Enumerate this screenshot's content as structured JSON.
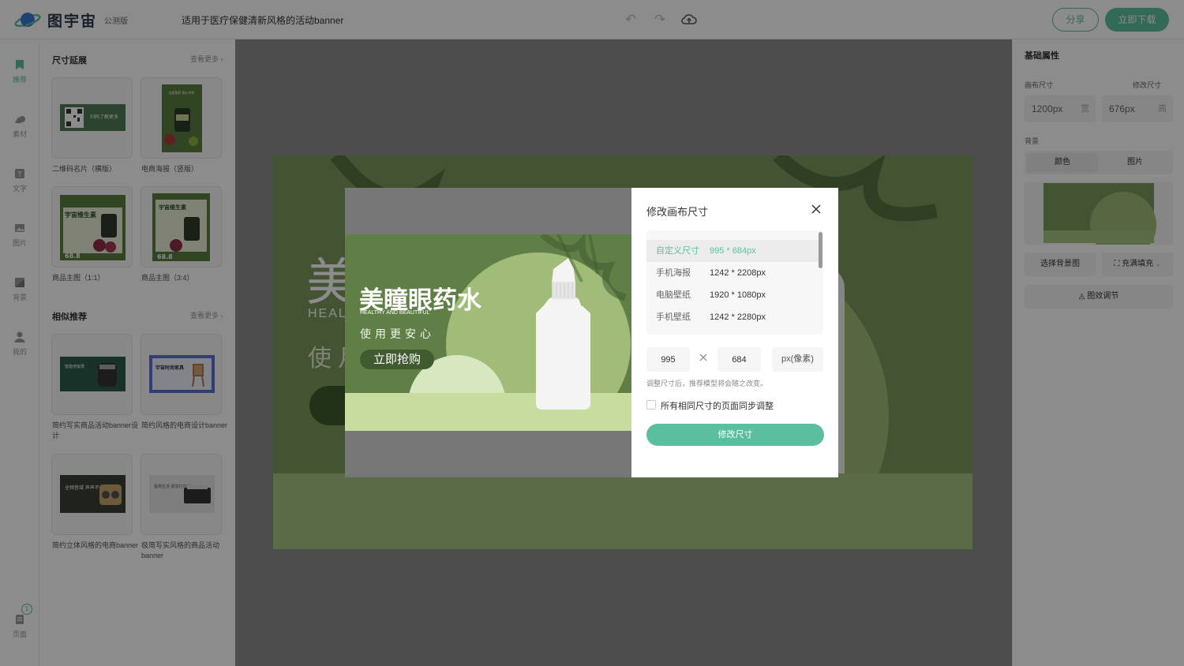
{
  "header": {
    "logo_text": "图宇宙",
    "logo_badge": "公测版",
    "doc_title": "适用于医疗保健清新风格的活动banner",
    "share_label": "分享",
    "download_label": "立即下载"
  },
  "leftnav": {
    "items": [
      {
        "label": "推荐",
        "icon": "recommend-icon"
      },
      {
        "label": "素材",
        "icon": "material-icon"
      },
      {
        "label": "文字",
        "icon": "text-icon"
      },
      {
        "label": "图片",
        "icon": "image-icon"
      },
      {
        "label": "背景",
        "icon": "background-icon"
      },
      {
        "label": "我的",
        "icon": "user-icon"
      }
    ],
    "pages_label": "页面",
    "pages_count": "1"
  },
  "templates": {
    "size_section_title": "尺寸延展",
    "similar_section_title": "相似推荐",
    "more_label": "查看更多",
    "size_items": [
      {
        "label": "二维码名片（横版）",
        "thumb_text": "扫码了解更多"
      },
      {
        "label": "电商海报（竖版）",
        "thumb_text": "全面营养 贴心守护"
      },
      {
        "label": "商品主图（1:1）",
        "thumb_text": "宇宙维生素",
        "price": "68.8"
      },
      {
        "label": "商品主图（3:4）",
        "thumb_text": "宇宙维生素",
        "price": "68.8"
      }
    ],
    "similar_items": [
      {
        "label": "简约写实商品活动banner设计",
        "thumb_text": "智能电饭煲"
      },
      {
        "label": "简约风格的电商设计banner",
        "thumb_text": "宇宙时尚家具"
      },
      {
        "label": "简约立体风格的电商banner",
        "thumb_text": "全频音域 声声不凡"
      },
      {
        "label": "极简写实风格的商品活动banner",
        "thumb_text": "极简生活 便享打印机"
      }
    ]
  },
  "canvas": {
    "title_partial": "美",
    "sub_partial": "HEALT",
    "tag_partial": "使月"
  },
  "rpanel": {
    "title": "基础属性",
    "canvas_size_label": "画布尺寸",
    "modify_size_label": "修改尺寸",
    "width_value": "1200px",
    "width_unit": "宽",
    "height_value": "676px",
    "height_unit": "高",
    "background_label": "背景",
    "tab_color": "颜色",
    "tab_image": "图片",
    "choose_bg_label": "选择背景图",
    "fill_label": "充满填充",
    "effect_label": "图效调节"
  },
  "preview": {
    "title": "美瞳眼药水",
    "subtitle": "HEALTHY AND BEAUTIFUL",
    "tagline": "使用更安心",
    "cta": "立即抢购"
  },
  "dialog": {
    "title": "修改画布尺寸",
    "sizes": [
      {
        "name": "自定义尺寸",
        "value": "995 * 684px",
        "selected": true
      },
      {
        "name": "手机海报",
        "value": "1242 * 2208px",
        "selected": false
      },
      {
        "name": "电脑壁纸",
        "value": "1920 * 1080px",
        "selected": false
      },
      {
        "name": "手机壁纸",
        "value": "1242 * 2280px",
        "selected": false
      }
    ],
    "width_input": "995",
    "height_input": "684",
    "unit": "px(像素)",
    "hint": "调整尺寸后，推荐模型将会随之改变。",
    "sync_label": "所有相同尺寸的页面同步调整",
    "sync_checked": false,
    "submit_label": "修改尺寸"
  },
  "colors": {
    "accent": "#5bbf9f",
    "banner_green": "#5f7f46",
    "light_green": "#a6c182"
  }
}
